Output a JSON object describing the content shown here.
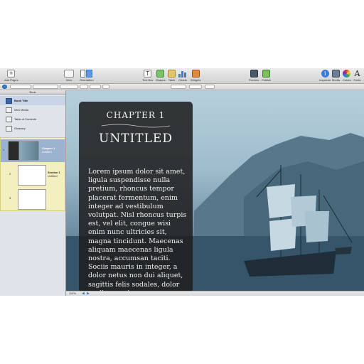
{
  "toolbar": {
    "left": [
      {
        "label": "Add Pages",
        "icon": "plus-icon"
      },
      {
        "label": "View",
        "icon": "view-icon"
      },
      {
        "label": "Orientation",
        "icon": "orientation-icon"
      }
    ],
    "middle": [
      {
        "label": "Text Box",
        "icon": "textbox-icon"
      },
      {
        "label": "Shapes",
        "icon": "shapes-icon"
      },
      {
        "label": "Table",
        "icon": "table-icon"
      },
      {
        "label": "Charts",
        "icon": "charts-icon"
      },
      {
        "label": "Widgets",
        "icon": "widgets-icon"
      }
    ],
    "preview": [
      {
        "label": "Preview",
        "icon": "preview-icon"
      },
      {
        "label": "Publish",
        "icon": "publish-icon"
      }
    ],
    "right": [
      {
        "label": "Inspector",
        "icon": "inspector-icon"
      },
      {
        "label": "Media",
        "icon": "media-icon"
      },
      {
        "label": "Colors",
        "icon": "colors-icon"
      },
      {
        "label": "Fonts",
        "icon": "fonts-icon"
      }
    ]
  },
  "sidebar": {
    "header": "Book",
    "items": [
      {
        "label": "Book Title"
      },
      {
        "label": "Intro Media"
      },
      {
        "label": "Table of Contents"
      },
      {
        "label": "Glossary"
      }
    ],
    "chapter": {
      "number": "1",
      "title": "Chapter 1",
      "subtitle": "Untitled"
    },
    "section": {
      "number": "2",
      "title": "Section 1",
      "subtitle": "Untitled"
    },
    "page3_number": "3"
  },
  "page": {
    "chapter_label": "CHAPTER 1",
    "title": "UNTITLED",
    "body": "Lorem ipsum dolor sit amet, ligula suspendisse nulla pretium, rhoncus tempor placerat fermentum, enim integer ad vestibulum volutpat. Nisl rhoncus turpis est, vel elit, congue wisi enim nunc ultricies sit, magna tincidunt. Maecenas aliquam maecenas ligula nostra, accumsan taciti. Sociis mauris in integer, a dolor netus non dui aliquet, sagittis felis sodales, dolor sociis mauris."
  },
  "statusbar": {
    "zoom": "110%"
  },
  "colors": {
    "accent": "#3a7bd5",
    "chapter_highlight": "#f4efbf",
    "panel": "#202020"
  }
}
